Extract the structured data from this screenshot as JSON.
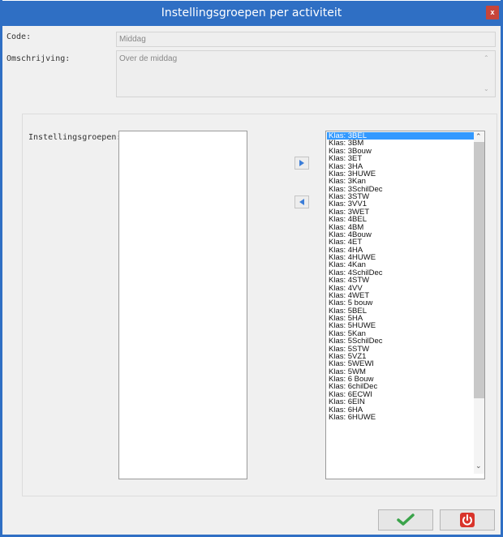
{
  "window": {
    "title": "Instellingsgroepen per activiteit",
    "close_glyph": "x"
  },
  "form": {
    "code_label": "Code:",
    "code_value": "Middag",
    "description_label": "Omschrijving:",
    "description_value": "Over de middag",
    "groups_label": "Instellingsgroepen:"
  },
  "lists": {
    "selected_items": [],
    "available_items": [
      "Klas: 3BEL",
      "Klas: 3BM",
      "Klas: 3Bouw",
      "Klas: 3ET",
      "Klas: 3HA",
      "Klas: 3HUWE",
      "Klas: 3Kan",
      "Klas: 3SchilDec",
      "Klas: 3STW",
      "Klas: 3VV1",
      "Klas: 3WET",
      "Klas: 4BEL",
      "Klas: 4BM",
      "Klas: 4Bouw",
      "Klas: 4ET",
      "Klas: 4HA",
      "Klas: 4HUWE",
      "Klas: 4Kan",
      "Klas: 4SchilDec",
      "Klas: 4STW",
      "Klas: 4VV",
      "Klas: 4WET",
      "Klas: 5 bouw",
      "Klas: 5BEL",
      "Klas: 5HA",
      "Klas: 5HUWE",
      "Klas: 5Kan",
      "Klas: 5SchilDec",
      "Klas: 5STW",
      "Klas: 5VZ1",
      "Klas: 5WEWI",
      "Klas: 5WM",
      "Klas: 6 Bouw",
      "Klas: 6chilDec",
      "Klas: 6ECWI",
      "Klas: 6EIN",
      "Klas: 6HA",
      "Klas: 6HUWE"
    ],
    "selected_index": 0
  },
  "icons": {
    "move_right": "arrow-right-icon",
    "move_left": "arrow-left-icon",
    "confirm": "checkmark-icon",
    "cancel": "power-icon"
  },
  "colors": {
    "titlebar": "#2f6fc4",
    "selection": "#3399ff",
    "confirm_green": "#3aa34a",
    "cancel_red": "#d9342b"
  }
}
